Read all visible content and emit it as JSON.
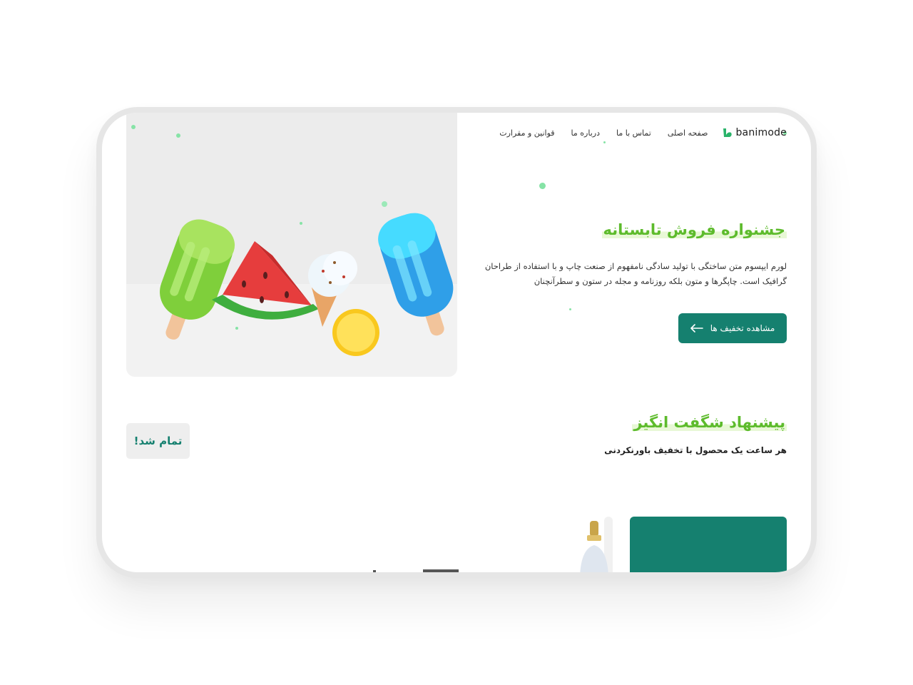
{
  "brand": {
    "name": "banimode",
    "accent": "#15806f",
    "highlight": "#5dbb2c"
  },
  "nav": {
    "links": [
      {
        "label": "صفحه اصلی"
      },
      {
        "label": "تماس با ما"
      },
      {
        "label": "درباره ما"
      },
      {
        "label": "قوانین و مقرارت"
      }
    ]
  },
  "hero": {
    "title": "جشنواره فروش تابستانه",
    "description": "لورم ایپسوم متن ساختگی با تولید سادگی نامفهوم از صنعت چاپ و با استفاده از طراحان گرافیک است. چاپگرها و متون بلکه روزنامه و مجله در ستون و سطرآنچنان",
    "cta_label": "مشاهده تخفیف ها",
    "cta_icon": "arrow-left-icon"
  },
  "offers": {
    "title": "پیشنهاد شگفت انگیز",
    "subtitle": "هر ساعت یک محصول با تخفیف باورنکردنی",
    "status": "تمام شد!"
  }
}
